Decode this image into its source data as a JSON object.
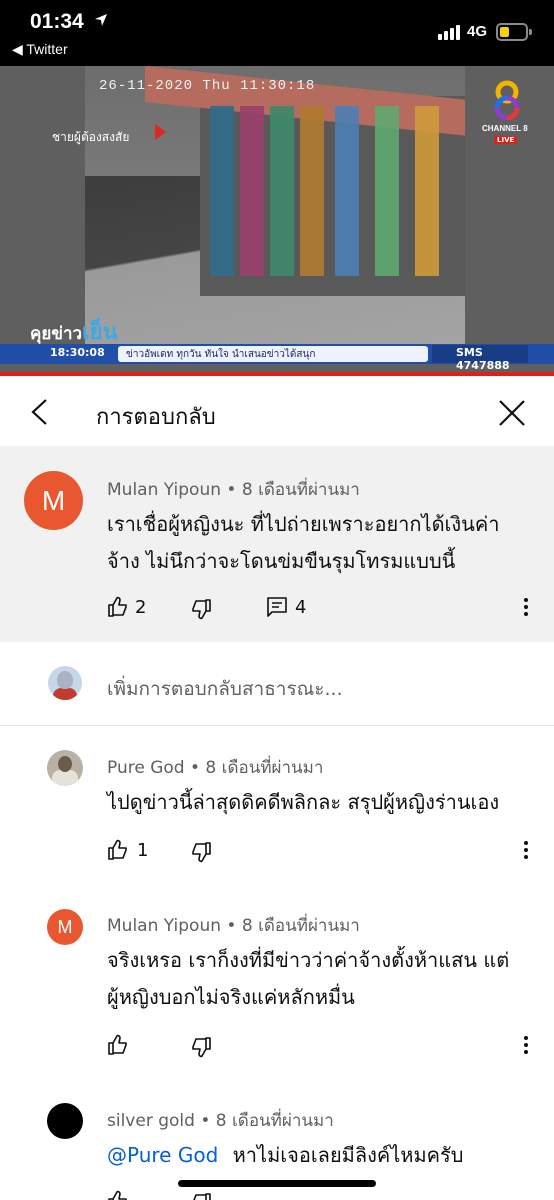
{
  "status_bar": {
    "time": "01:34",
    "back_app": "◀ Twitter",
    "network": "4G",
    "battery_level": 0.3,
    "colors": {
      "battery": "#f5d20c"
    }
  },
  "video": {
    "timestamp": "26-11-2020 Thu 11:30:18",
    "overlay_tag": "ชายผู้ต้องสงสัย",
    "channel": "CHANNEL 8",
    "live": "LIVE",
    "show_name_a": "คุยข่าว",
    "show_name_b": "เย็น",
    "ticker_time": "18:30:08",
    "ticker_text": "ข่าวอัพเดท ทุกวัน ทันใจ นำเสนอข่าวได้สนุก",
    "sms": "SMS 4747888",
    "colors": {
      "ticker": "#1f4fa8",
      "accent": "#e21d1d"
    }
  },
  "header": {
    "title": "การตอบกลับ",
    "back_icon": "chevron-left-icon",
    "close_icon": "close-icon"
  },
  "parent_comment": {
    "avatar_letter": "M",
    "author": "Mulan Yipoun",
    "time": "8 เดือนที่ผ่านมา",
    "text_line1": "เราเชื่อผู้หญิงนะ ที่ไปถ่ายเพราะอยากได้เงินค่า",
    "text_line2": "จ้าง ไม่นึกว่าจะโดนข่มขืนรุมโทรมแบบนี้",
    "likes": "2",
    "replies": "4"
  },
  "add_reply": {
    "placeholder": "เพิ่มการตอบกลับสาธารณะ..."
  },
  "replies": [
    {
      "author": "Pure God",
      "time": "8 เดือนที่ผ่านมา",
      "text_line1": "ไปดูข่าวนี้ล่าสุดดิคดีพลิกละ สรุปผู้หญิงร่านเอง",
      "likes": "1"
    },
    {
      "avatar_letter": "M",
      "author": "Mulan Yipoun",
      "time": "8 เดือนที่ผ่านมา",
      "text_line1": "จริงเหรอ เราก็งงที่มีข่าวว่าค่าจ้างตั้งห้าแสน แต่",
      "text_line2": "ผู้หญิงบอกไม่จริงแค่หลักหมื่น"
    },
    {
      "author": "silver gold",
      "time": "8 เดือนที่ผ่านมา",
      "mention": "@Pure God",
      "text_line1": "หาไม่เจอเลยมีลิงค์ไหมครับ"
    }
  ],
  "separator": "•"
}
